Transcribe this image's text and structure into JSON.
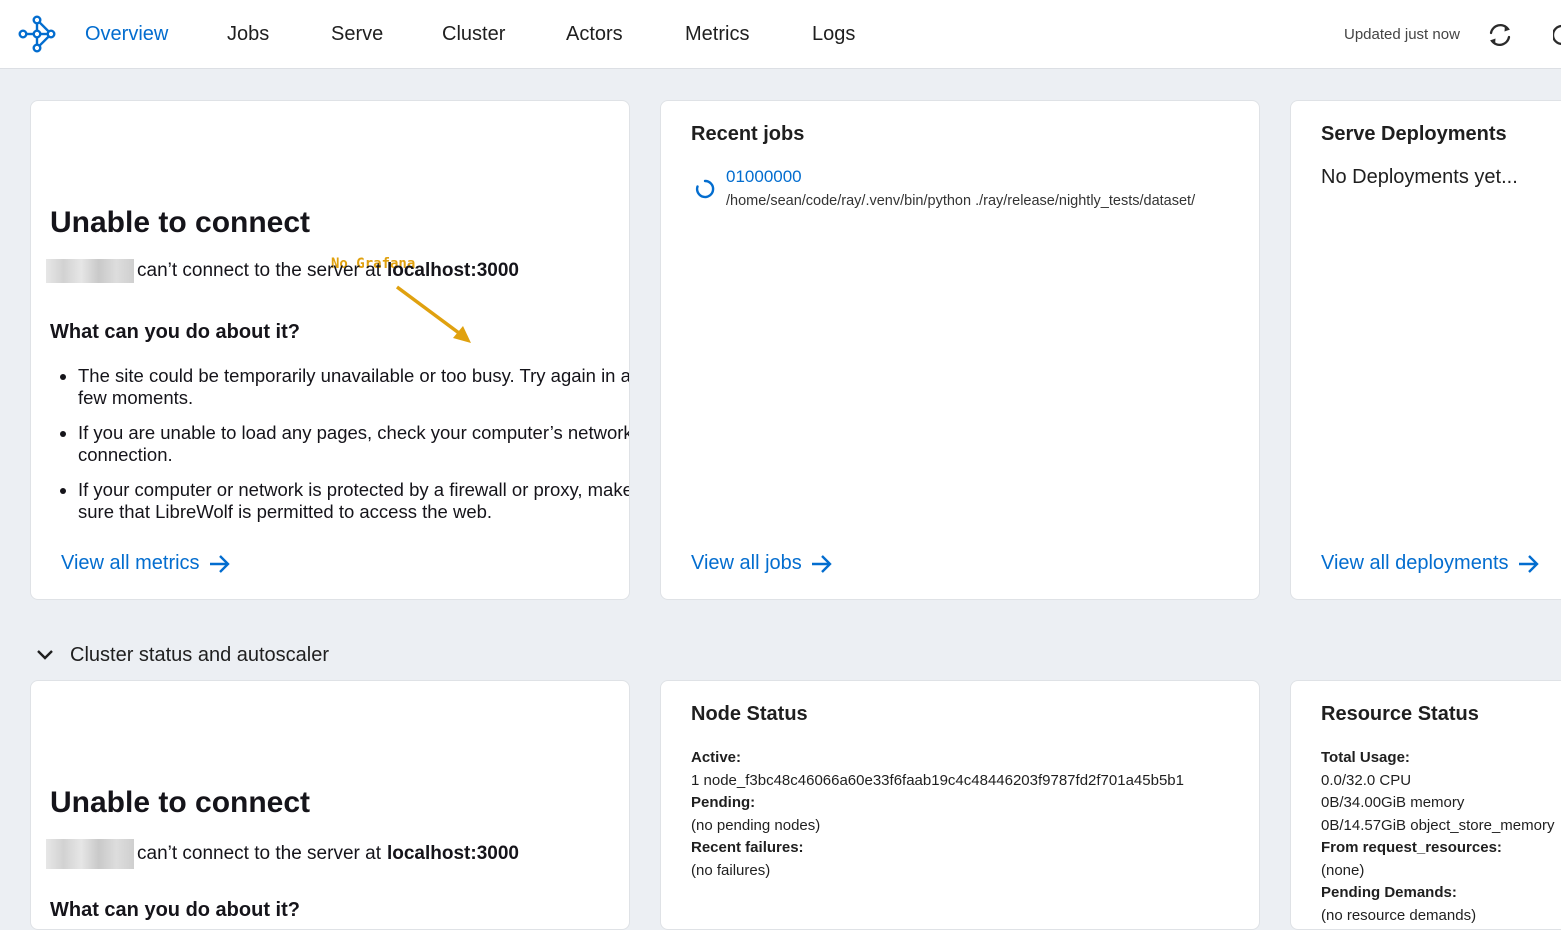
{
  "nav": {
    "tabs": [
      "Overview",
      "Jobs",
      "Serve",
      "Cluster",
      "Actors",
      "Metrics",
      "Logs"
    ],
    "active": "Overview",
    "updated_text": "Updated just now",
    "icons": [
      "ray-logo-icon",
      "refresh-icon"
    ]
  },
  "metrics_card": {
    "annotation": "No Grafana",
    "error_title": "Unable to connect",
    "error_line": "can’t connect to the server at",
    "error_host": "localhost:3000",
    "subtitle": "What can you do about it?",
    "tips": [
      "The site could be temporarily unavailable or too busy. Try again in a few moments.",
      "If you are unable to load any pages, check your computer’s network connection.",
      "If your computer or network is protected by a firewall or proxy, make sure that LibreWolf is permitted to access the web."
    ],
    "link": "View all metrics"
  },
  "jobs_card": {
    "title": "Recent jobs",
    "job_id": "01000000",
    "job_command": "/home/sean/code/ray/.venv/bin/python ./ray/release/nightly_tests/dataset/",
    "link": "View all jobs"
  },
  "serve_card": {
    "title": "Serve Deployments",
    "empty_text": "No Deployments yet...",
    "link": "View all deployments"
  },
  "cluster_section": {
    "title": "Cluster status and autoscaler",
    "autoscaler_card": {
      "error_title": "Unable to connect",
      "error_line": "can’t connect to the server at",
      "error_host": "localhost:3000",
      "subtitle": "What can you do about it?"
    },
    "node_status": {
      "title": "Node Status",
      "active_label": "Active:",
      "active_value": "1 node_f3bc48c46066a60e33f6faab19c4c48446203f9787fd2f701a45b5b1",
      "pending_label": "Pending:",
      "pending_value": "(no pending nodes)",
      "failures_label": "Recent failures:",
      "failures_value": "(no failures)"
    },
    "resource_status": {
      "title": "Resource Status",
      "usage_label": "Total Usage:",
      "cpu": "0.0/32.0 CPU",
      "memory": "0B/34.00GiB memory",
      "object_store": "0B/14.57GiB object_store_memory",
      "request_label": "From request_resources:",
      "request_value": "(none)",
      "demands_label": "Pending Demands:",
      "demands_value": "(no resource demands)"
    }
  },
  "colors": {
    "accent": "#036dcf",
    "annotation": "#e0a10f",
    "background": "#eceff3"
  }
}
